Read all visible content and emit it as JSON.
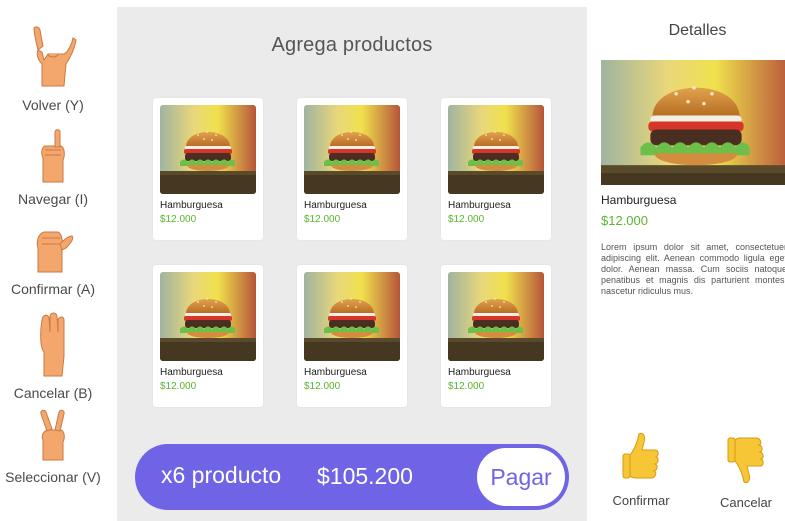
{
  "gestures": [
    {
      "label": "Volver (Y)",
      "icon": "shaka-hand-icon"
    },
    {
      "label": "Navegar (I)",
      "icon": "pinky-up-hand-icon"
    },
    {
      "label": "Confirmar (A)",
      "icon": "fist-thumb-hand-icon"
    },
    {
      "label": "Cancelar (B)",
      "icon": "flat-hand-icon"
    },
    {
      "label": "Seleccionar (V)",
      "icon": "victory-hand-icon"
    }
  ],
  "catalog": {
    "title": "Agrega productos",
    "products": [
      {
        "name": "Hamburguesa",
        "price": "$12.000"
      },
      {
        "name": "Hamburguesa",
        "price": "$12.000"
      },
      {
        "name": "Hamburguesa",
        "price": "$12.000"
      },
      {
        "name": "Hamburguesa",
        "price": "$12.000"
      },
      {
        "name": "Hamburguesa",
        "price": "$12.000"
      },
      {
        "name": "Hamburguesa",
        "price": "$12.000"
      }
    ]
  },
  "cart": {
    "quantity_label": "x6 producto",
    "total": "$105.200",
    "pay_label": "Pagar"
  },
  "details": {
    "title": "Detalles",
    "name": "Hamburguesa",
    "price": "$12.000",
    "description": "Lorem ipsum dolor sit amet, consectetuer adipiscing elit. Aenean commodo ligula eget dolor. Aenean massa. Cum sociis natoque penatibus et magnis dis parturient montes, nascetur ridiculus mus.",
    "confirm_label": "Confirmar",
    "cancel_label": "Cancelar"
  },
  "colors": {
    "accent": "#6f63e6",
    "price_green": "#5ab52c",
    "panel_bg": "#ebebeb",
    "skin": "#f4a76c",
    "emoji_yellow": "#f7c636"
  }
}
